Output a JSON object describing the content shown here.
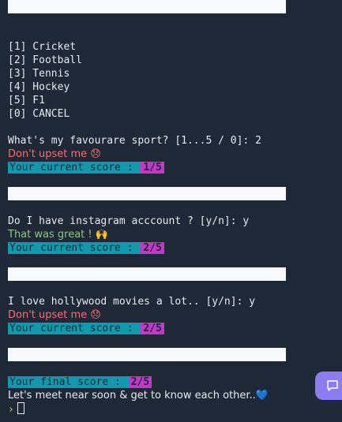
{
  "menu": {
    "items": [
      "[1] Cricket",
      "[2] Football",
      "[3] Tennis",
      "[4] Hockey",
      "[5] F1",
      "[0] CANCEL"
    ]
  },
  "q1": {
    "question": "What's my favourare sport? [1...5 / 0]: 2",
    "response": "Don't upset me 😞",
    "score_label": "Your current score : ",
    "score_value": "1/5"
  },
  "q2": {
    "question": "Do I have instagram acccount ? [y/n]: y",
    "response": "That was great ! 🙌",
    "score_label": "Your current score : ",
    "score_value": "2/5"
  },
  "q3": {
    "question": "I love hollywood movies a lot.. [y/n]: y",
    "response": "Don't upset me 😞",
    "score_label": "Your current score : ",
    "score_value": "2/5"
  },
  "final": {
    "score_label": "Your final score : ",
    "score_value": "2/5",
    "message": "Let's meet near soon & get to know each other..💙"
  },
  "prompt": {
    "symbol": "›"
  },
  "colors": {
    "background": "#1f2837",
    "separator": "#f7f9fc",
    "score_label_bg": "#1199ad",
    "score_value_bg": "#c237c8",
    "negative": "#ff6b6b",
    "positive": "#8fc77a",
    "chat_button": "#8c7cf0"
  },
  "icons": {
    "chat_button": "chat-bubble-icon"
  }
}
